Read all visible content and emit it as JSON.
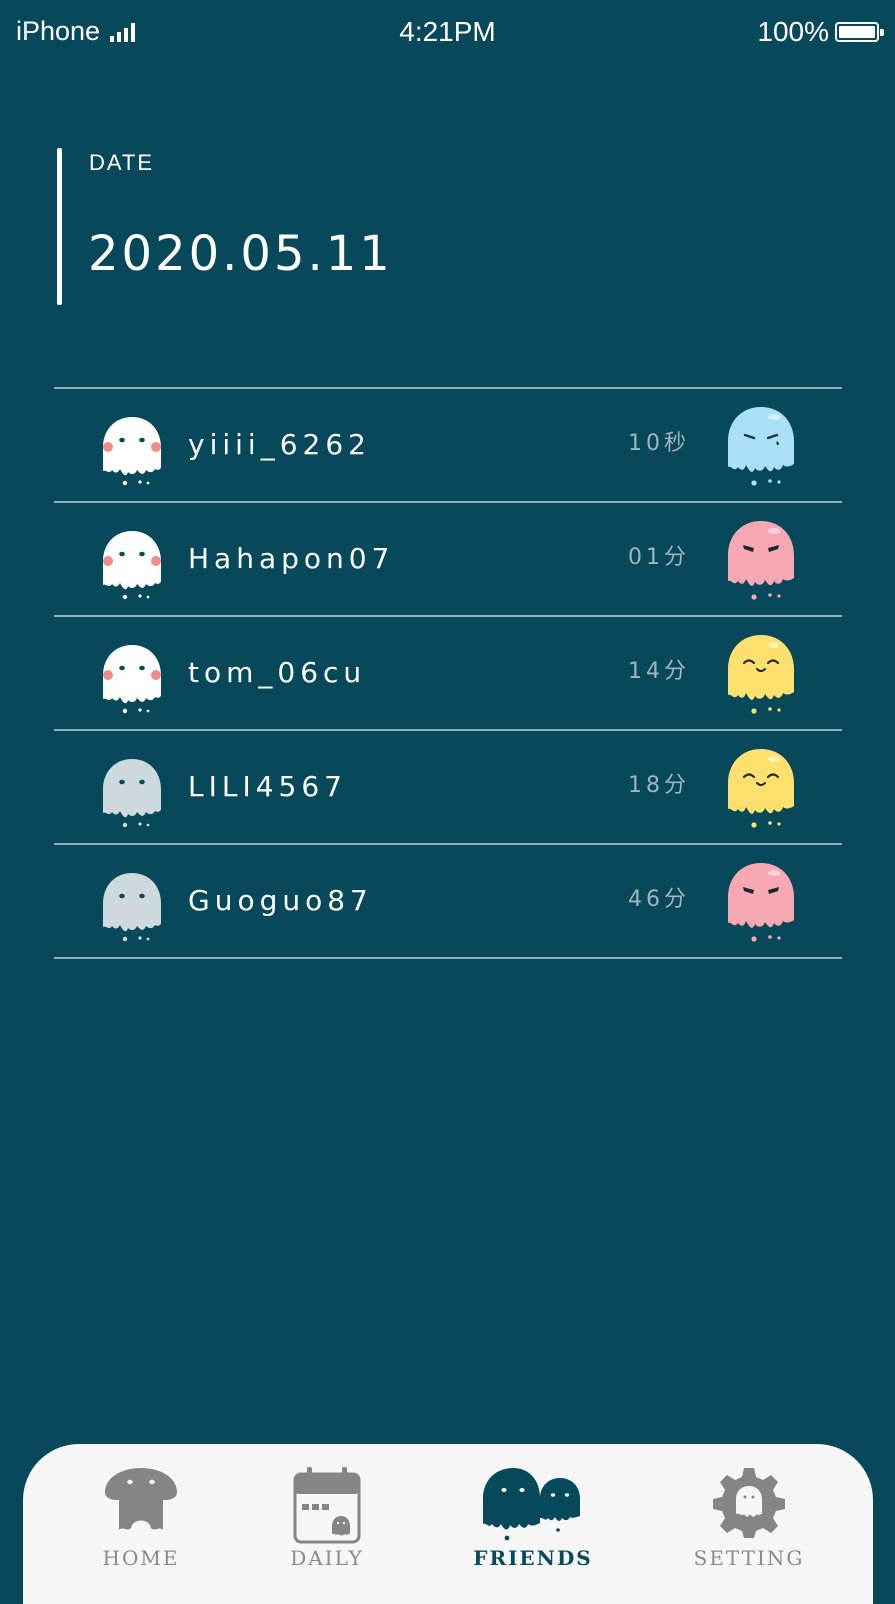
{
  "status_bar": {
    "carrier": "iPhone",
    "time": "4:21PM",
    "battery": "100%"
  },
  "date_section": {
    "label": "DATE",
    "value": "2020.05.11"
  },
  "friends": [
    {
      "name": "yiiii_6262",
      "time": "10秒",
      "avatar": "white-blush-ghost-icon",
      "mood": "blue-sad-ghost-icon",
      "mood_color": "#a9e0f7"
    },
    {
      "name": "Hahapon07",
      "time": "01分",
      "avatar": "white-blush-ghost-icon",
      "mood": "pink-angry-ghost-icon",
      "mood_color": "#f6a8b3"
    },
    {
      "name": "tom_06cu",
      "time": "14分",
      "avatar": "white-blush-ghost-icon",
      "mood": "yellow-happy-ghost-icon",
      "mood_color": "#fde06d"
    },
    {
      "name": "LILI4567",
      "time": "18分",
      "avatar": "gray-ghost-icon",
      "mood": "yellow-happy-ghost-icon",
      "mood_color": "#fde06d"
    },
    {
      "name": "Guoguo87",
      "time": "46分",
      "avatar": "gray-ghost-icon",
      "mood": "pink-angry-ghost-icon",
      "mood_color": "#f6a8b3"
    }
  ],
  "tab_bar": {
    "tabs": [
      {
        "label": "HOME",
        "icon": "mushroom-ghost-icon"
      },
      {
        "label": "DAILY",
        "icon": "calendar-icon"
      },
      {
        "label": "FRIENDS",
        "icon": "two-ghosts-icon",
        "active": true
      },
      {
        "label": "SETTING",
        "icon": "gear-icon"
      }
    ]
  },
  "colors": {
    "background": "#07495b",
    "divider": "#8fb0ba",
    "tab_bar": "#f6f6f6",
    "tab_inactive": "#8a8a8a",
    "tab_active": "#074a5c"
  }
}
